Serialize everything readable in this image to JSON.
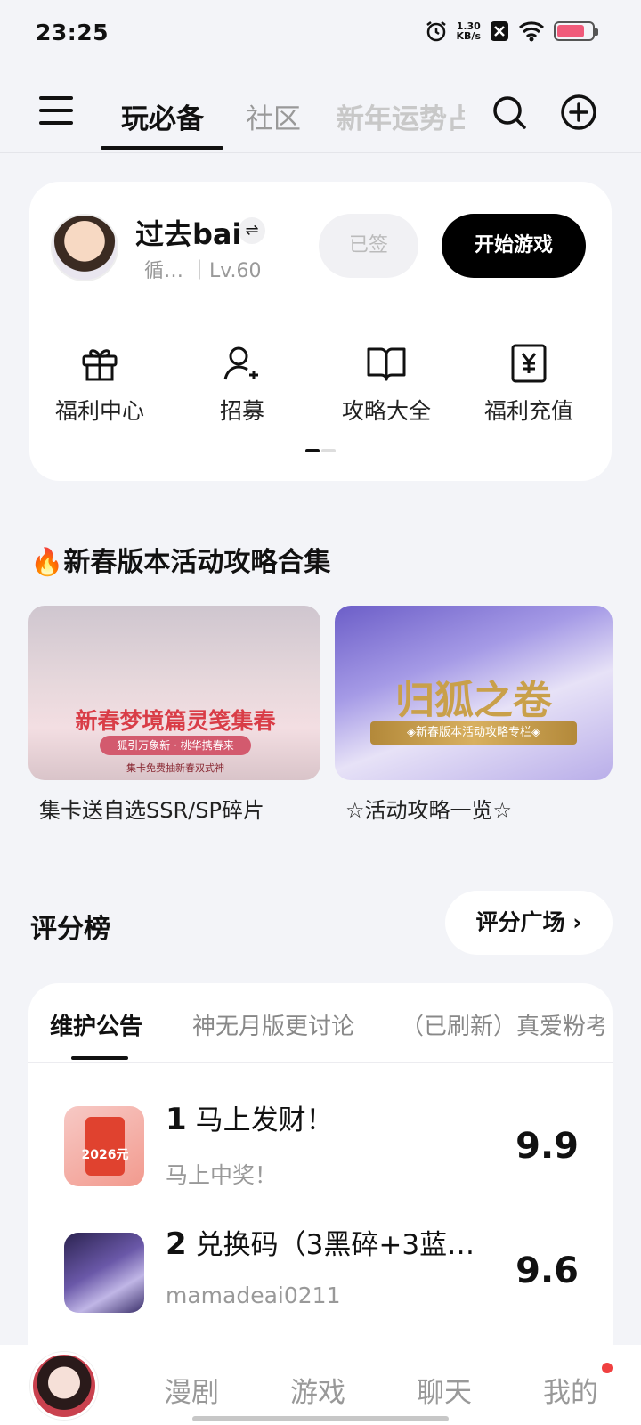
{
  "status_bar": {
    "time": "23:25",
    "net_speed_value": "1.30",
    "net_speed_unit": "KB/s",
    "icons": [
      "alarm-icon",
      "close-box-icon",
      "wifi-icon",
      "battery-icon"
    ],
    "battery_color": "#f05a7a"
  },
  "top_nav": {
    "tabs": [
      {
        "label": "玩必备",
        "active": true
      },
      {
        "label": "社区",
        "active": false
      },
      {
        "label": "新年运势占卜",
        "active": false
      }
    ],
    "icons": [
      "menu-icon",
      "search-icon",
      "add-circle-icon"
    ]
  },
  "profile": {
    "username": "过去bai",
    "subtitle": "循… ｜Lv.60",
    "signed_label": "已签",
    "start_label": "开始游戏"
  },
  "quick_actions": [
    {
      "label": "福利中心",
      "icon": "gift-icon"
    },
    {
      "label": "招募",
      "icon": "add-user-icon"
    },
    {
      "label": "攻略大全",
      "icon": "book-icon"
    },
    {
      "label": "福利充值",
      "icon": "yen-card-icon"
    }
  ],
  "event_section": {
    "title": "🔥新春版本活动攻略合集",
    "banners": [
      {
        "title": "新春梦境篇灵笺集春",
        "subtitle": "狐引万象新 · 桃华携春来",
        "footnote": "集卡免费抽新春双式神",
        "caption": "集卡送自选SSR/SP碎片"
      },
      {
        "title": "归狐之卷",
        "subtitle": "◈新春版本活动攻略专栏◈",
        "caption": "☆活动攻略一览☆"
      }
    ]
  },
  "rating": {
    "title": "评分榜",
    "plaza_label": "评分广场 ›",
    "tabs": [
      {
        "label": "维护公告",
        "active": true
      },
      {
        "label": "神无月版更讨论",
        "active": false
      },
      {
        "label": "（已刷新）真爱粉考",
        "active": false
      }
    ],
    "items": [
      {
        "rank": "1",
        "name": "马上发财！",
        "sub": "马上中奖！",
        "score": "9.9",
        "icon_text": "2026元"
      },
      {
        "rank": "2",
        "name": "兑换码（3黑碎+3蓝…",
        "sub": "mamadeai0211",
        "score": "9.6"
      }
    ]
  },
  "bottom_nav": {
    "items": [
      "漫剧",
      "游戏",
      "聊天",
      "我的"
    ],
    "notification_color": "#f04040"
  }
}
